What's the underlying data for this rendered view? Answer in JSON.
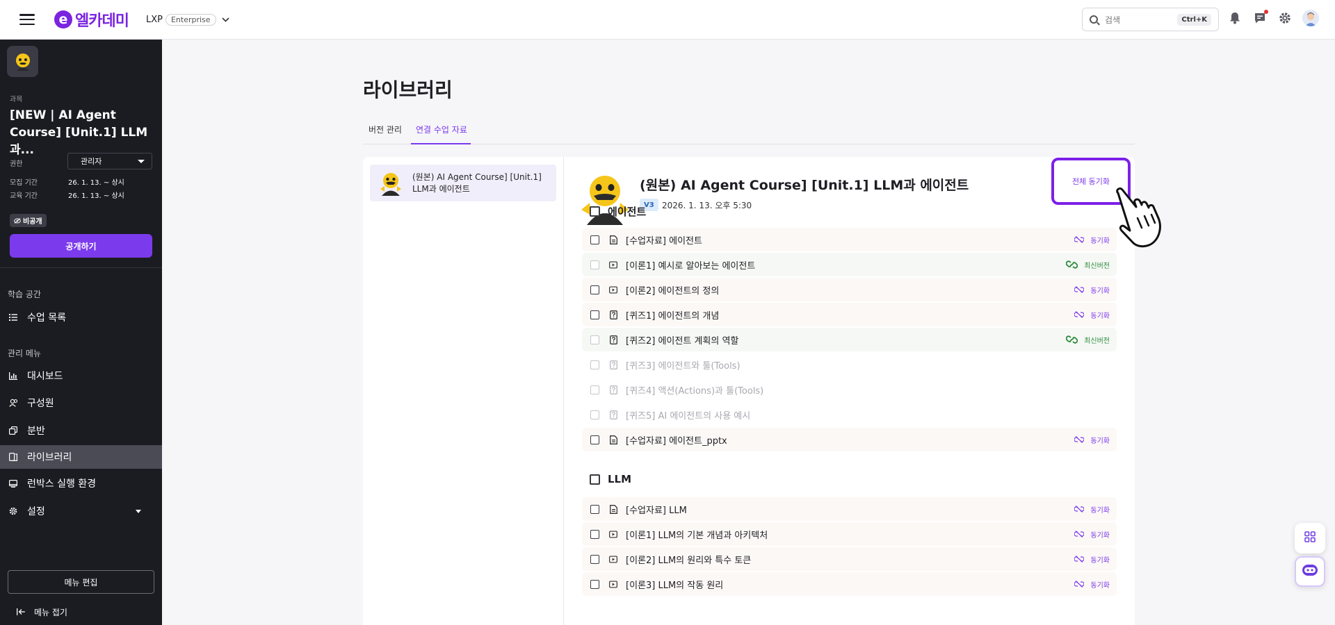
{
  "topbar": {
    "logo_mark": "e",
    "logo_text": "엘카데미",
    "product": "LXP",
    "product_badge": "Enterprise",
    "search_placeholder": "검색",
    "search_shortcut": "Ctrl+K"
  },
  "sidebar": {
    "caption": "과목",
    "course_title": "[NEW | AI Agent Course] [Unit.1] LLM과...",
    "role_label": "권한",
    "role_value": "관리자",
    "recruit_label": "모집 기간",
    "recruit_value": "26. 1. 13. ~ 상시",
    "edu_label": "교육 기간",
    "edu_value": "26. 1. 13. ~ 상시",
    "private_badge": "비공개",
    "publish_button": "공개하기",
    "section_learning": "학습 공간",
    "section_admin": "관리 메뉴",
    "items": {
      "lesson_list": "수업 목록",
      "dashboard": "대시보드",
      "members": "구성원",
      "groups": "분반",
      "library": "라이브러리",
      "runbox": "런박스 실행 환경",
      "settings": "설정"
    },
    "menu_edit": "메뉴 편집",
    "menu_fold": "메뉴 접기"
  },
  "main": {
    "title": "라이브러리",
    "tabs": [
      "버전 관리",
      "연결 수업 자료"
    ],
    "active_tab": 1,
    "library_item": "(원본) AI Agent Course] [Unit.1] LLM과 에이전트",
    "detail": {
      "title": "(원본) AI Agent Course] [Unit.1] LLM과 에이전트",
      "version": "V3",
      "date": "2026. 1. 13. 오후 5:30",
      "sync_all": "전체 동기화"
    },
    "status_labels": {
      "sync": "동기화",
      "latest": "최신버전"
    },
    "groups": [
      {
        "name": "에이전트",
        "rows": [
          {
            "label": "[수업자료] 에이전트",
            "icon": "document-icon",
            "status": "sync"
          },
          {
            "label": "[이론1] 예시로 알아보는 에이전트",
            "icon": "video-icon",
            "status": "latest"
          },
          {
            "label": "[이론2] 에이전트의 정의",
            "icon": "video-icon",
            "status": "sync"
          },
          {
            "label": "[퀴즈1] 에이전트의 개념",
            "icon": "quiz-icon",
            "status": "sync"
          },
          {
            "label": "[퀴즈2] 에이전트 계획의 역할",
            "icon": "quiz-icon",
            "status": "latest"
          },
          {
            "label": "[퀴즈3] 에이전트와 툴(Tools)",
            "icon": "quiz-icon",
            "status": "none"
          },
          {
            "label": "[퀴즈4] 액션(Actions)과 툴(Tools)",
            "icon": "quiz-icon",
            "status": "none"
          },
          {
            "label": "[퀴즈5] AI 에이전트의 사용 예시",
            "icon": "quiz-icon",
            "status": "none"
          },
          {
            "label": "[수업자료] 에이전트_pptx",
            "icon": "document-icon",
            "status": "sync"
          }
        ]
      },
      {
        "name": "LLM",
        "rows": [
          {
            "label": "[수업자료] LLM",
            "icon": "document-icon",
            "status": "sync"
          },
          {
            "label": "[이론1] LLM의 기본 개념과 아키텍처",
            "icon": "video-icon",
            "status": "sync"
          },
          {
            "label": "[이론2] LLM의 원리와 특수 토큰",
            "icon": "video-icon",
            "status": "sync"
          },
          {
            "label": "[이론3] LLM의 작동 원리",
            "icon": "video-icon",
            "status": "sync"
          }
        ]
      }
    ]
  },
  "colors": {
    "brand": "#7a24e0",
    "accent": "#7c3aed",
    "sidebar_bg": "#1b1c22",
    "latest_green": "#2c8a3c"
  }
}
